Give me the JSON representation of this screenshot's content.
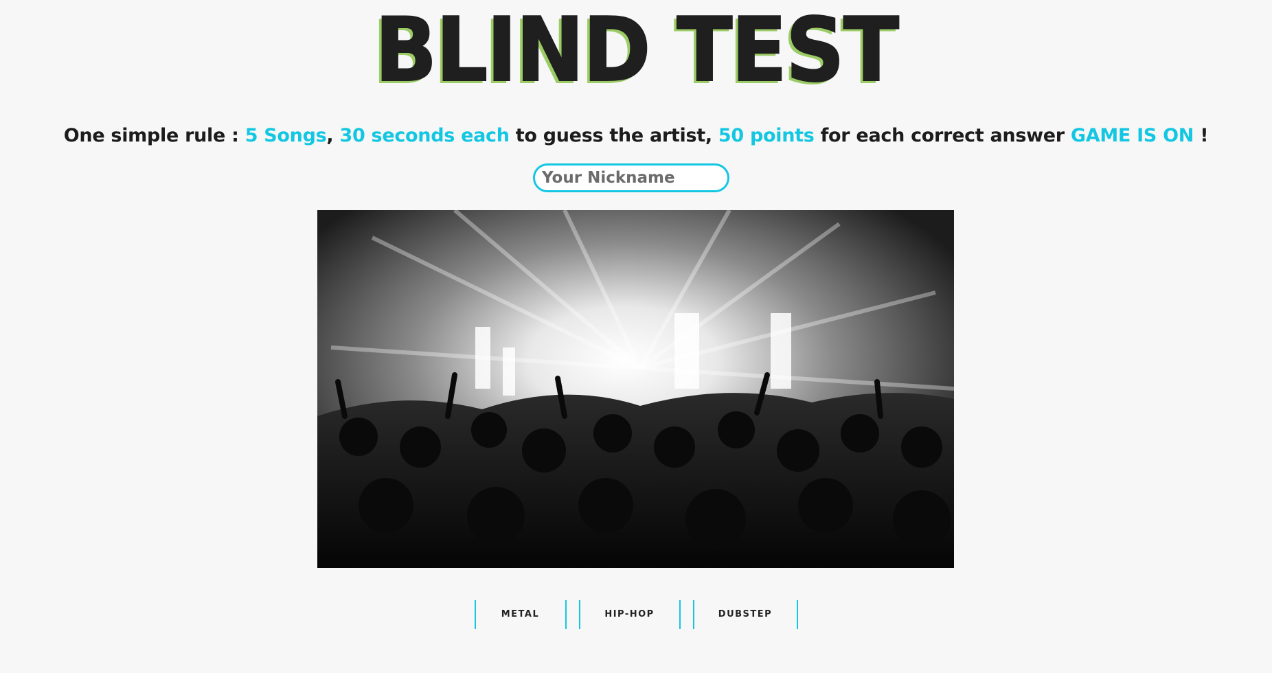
{
  "header": {
    "title": "BLIND TEST"
  },
  "rules": {
    "intro": "One simple rule : ",
    "songs": "5 Songs",
    "sep1": ", ",
    "seconds": "30 seconds each",
    "mid": " to guess the artist, ",
    "points": "50 points",
    "tail": " for each correct answer ",
    "game_on": "GAME IS ON",
    "end": " !"
  },
  "nickname": {
    "placeholder": "Your Nickname",
    "value": ""
  },
  "hero": {
    "image": "concert-crowd-photo"
  },
  "genres": [
    {
      "label": "METAL"
    },
    {
      "label": "HIP-HOP"
    },
    {
      "label": "DUBSTEP"
    }
  ],
  "colors": {
    "accent": "#13c7e3",
    "title_shadow": "#9ccc65",
    "text": "#1c1c1c",
    "background": "#f7f7f7"
  }
}
